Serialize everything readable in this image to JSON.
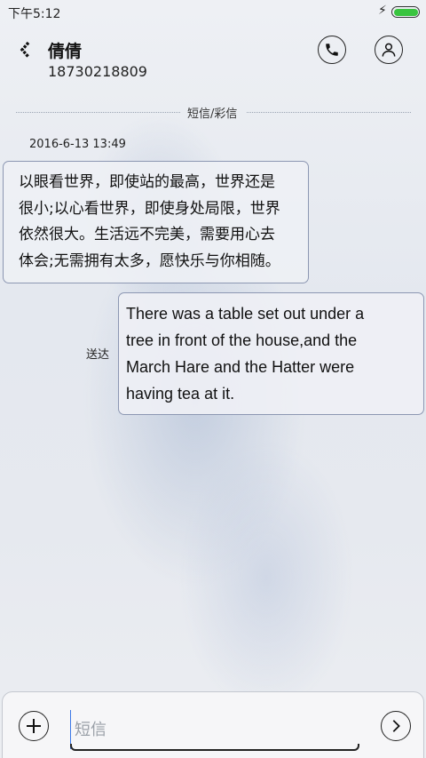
{
  "status_bar": {
    "time": "下午5:12",
    "charging_icon": "bolt-icon",
    "battery_color": "#39c43f"
  },
  "header": {
    "contact_name": "倩倩",
    "contact_phone": "18730218809",
    "back_icon": "chevron-left-icon",
    "call_icon": "phone-icon",
    "profile_icon": "person-icon"
  },
  "thread": {
    "channel_label": "短信/彩信",
    "timestamp": "2016-6-13 13:49",
    "messages": [
      {
        "direction": "incoming",
        "lines": [
          "以眼看世界，即使站的最高，世界还是",
          "很小;以心看世界，即使身处局限，世界",
          "依然很大。生活远不完美，需要用心去",
          "体会;无需拥有太多，愿快乐与你相随。"
        ]
      },
      {
        "direction": "outgoing",
        "status": "送达",
        "lines": [
          "There was a table set out under a",
          "tree in front of the house,and the",
          "March Hare and the Hatter were",
          "having tea at it."
        ]
      }
    ]
  },
  "composer": {
    "placeholder": "短信",
    "add_icon": "plus-circle-icon",
    "send_icon": "chevron-right-circle-icon"
  },
  "colors": {
    "accent_cursor": "#3b78e7",
    "bubble_border": "#8c97b2"
  }
}
